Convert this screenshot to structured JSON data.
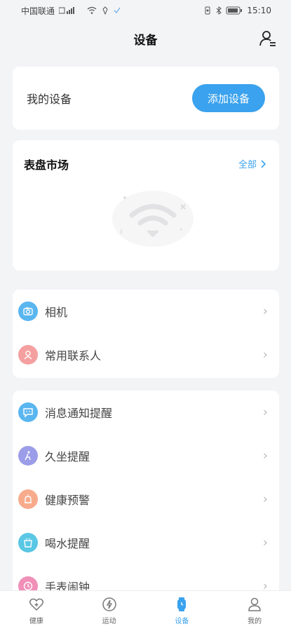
{
  "status_bar": {
    "carrier": "中国联通",
    "time": "15:10"
  },
  "header": {
    "title": "设备",
    "user_icon": "user-switch-icon"
  },
  "my_devices": {
    "label": "我的设备",
    "add_button": "添加设备"
  },
  "watch_market": {
    "title": "表盘市场",
    "all_link": "全部"
  },
  "list_group_1": [
    {
      "label": "相机",
      "icon": "camera-icon",
      "color": "#5ab6ef"
    },
    {
      "label": "常用联系人",
      "icon": "contact-icon",
      "color": "#f4a0a0"
    }
  ],
  "list_group_2": [
    {
      "label": "消息通知提醒",
      "icon": "message-icon",
      "color": "#5ab6ef"
    },
    {
      "label": "久坐提醒",
      "icon": "sitting-icon",
      "color": "#9c9de8"
    },
    {
      "label": "健康预警",
      "icon": "alarm-icon",
      "color": "#f7ab8c"
    },
    {
      "label": "喝水提醒",
      "icon": "cup-icon",
      "color": "#5ac7e4"
    },
    {
      "label": "手表闹钟",
      "icon": "clock-icon",
      "color": "#f08fb8"
    }
  ],
  "tabbar": {
    "tabs": [
      {
        "label": "健康",
        "icon": "heart-icon",
        "active": false
      },
      {
        "label": "运动",
        "icon": "bolt-icon",
        "active": false
      },
      {
        "label": "设备",
        "icon": "watch-icon",
        "active": true
      },
      {
        "label": "我的",
        "icon": "person-icon",
        "active": false
      }
    ]
  },
  "colors": {
    "accent": "#3aa2ee",
    "background": "#f3f4f6"
  }
}
